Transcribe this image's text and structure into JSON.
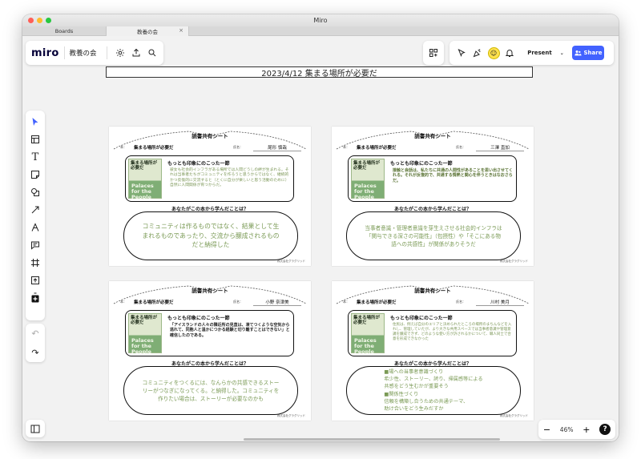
{
  "window": {
    "title": "Miro"
  },
  "tabs": [
    {
      "label": "Boards"
    },
    {
      "label": "教養の会",
      "close": "×"
    }
  ],
  "header": {
    "logo": "miro",
    "board_name": "教養の会",
    "present_label": "Present",
    "share_label": "Share"
  },
  "board": {
    "title": "2023/4/12 集まる場所が必要だ"
  },
  "zoom": {
    "minus": "−",
    "level": "46%",
    "plus": "+",
    "help": "?"
  },
  "sheet_common": {
    "title": "読書共有シート",
    "theme_label": "本：",
    "theme": "集まる場所が必要だ",
    "name_label": "氏名：",
    "quote_heading": "もっとも印象にのこった一節",
    "learn_heading": "あなたがこの本から学んだことは？",
    "footer": "株式会社グラグリッド",
    "book_jp": "集まる場所が必要だ",
    "book_en": "Palaces for the People"
  },
  "sheets": [
    {
      "name": "尾形 慎哉",
      "quote": "彼女も社会的インフラがある場所では人間どうしの絆が生まれる。それは当事者たちがコミュニティを作ろうと思うからではなく、継続的かつ反復的に交流すると（とくに自分が楽しいと思う活動のために）自然に人間関係が育つからだ。",
      "learn": "コミュニティは作るものではなく、結果として生まれるものであったり、交流から醸成されるものだと納得した"
    },
    {
      "name": "三澤 直加",
      "quote": "接触と会話は、私たちに共通の人間性があることを思い出させてくれる。それが反復的で、共通する情熱と関心を伴うときはなおさらだ。",
      "learn": "当事者意識・管理者意識を芽生えさせる社会的インフラは「関与できる深さの可能性」（包摂性）や「そこにある物語への共感性」が関係がありそうだ"
    },
    {
      "name": "小野 奈津美",
      "quote": "「アイスランドの人々の隣近所の見直は、凍てつくような空気から逃れて、同胞人と温かにつかる経験と切り離すことはできない」と確信したのである。",
      "learn": "コミュニティをつくるには、なんらかの共感できるストーリーがつなぎになってくる。と納得した。コミュニティを作りたい場合は、ストーリーが必要なのかも"
    },
    {
      "name": "川村 美月",
      "quote": "住民は、例えば自分のエリアと決められたところの場所のまちんなどを入れし、管理していたが、より大きな共用スペースでは当事者意識や管理意識を醸成できず、どのような使い方が許されるかについて、職人同士で合意を形成できなかった",
      "learn_lines": [
        "■場への当事者意識づくり",
        "希少性、ストーリー、誇り、帰属感等による",
        "共感をどう生むかが重要そう",
        "■関係性づくり",
        "信頼を構築し合うための共通テーマ、",
        "助け合いをどう生みだすか"
      ]
    }
  ],
  "colors": {
    "accent": "#4262ff",
    "learn_text": "#7a9a55",
    "quote_text": "#7b9656"
  }
}
